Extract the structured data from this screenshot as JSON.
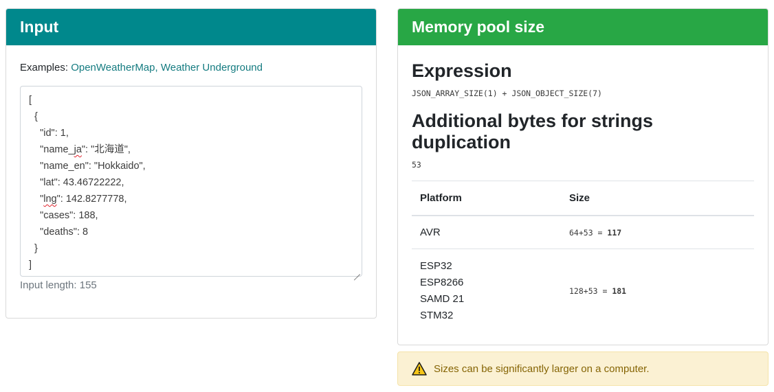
{
  "input_card": {
    "title": "Input",
    "examples_label": "Examples:",
    "example_links": [
      "OpenWeatherMap,",
      "Weather Underground"
    ],
    "json_lines": [
      "[",
      "  {",
      "    \"id\": 1,",
      "    \"name_ja\": \"北海道\",",
      "    \"name_en\": \"Hokkaido\",",
      "    \"lat\": 43.46722222,",
      "    \"lng\": 142.8277778,",
      "    \"cases\": 188,",
      "    \"deaths\": 8",
      "  }",
      "]"
    ],
    "input_length": "Input length: 155"
  },
  "result_card": {
    "title": "Memory pool size",
    "expression_heading": "Expression",
    "expression": "JSON_ARRAY_SIZE(1) + JSON_OBJECT_SIZE(7)",
    "additional_heading": "Additional bytes for strings duplication",
    "additional_bytes": "53",
    "table": {
      "headers": [
        "Platform",
        "Size"
      ],
      "rows": [
        {
          "platforms": [
            "AVR"
          ],
          "formula": "64+53 = ",
          "result": "117"
        },
        {
          "platforms": [
            "ESP32",
            "ESP8266",
            "SAMD 21",
            "STM32"
          ],
          "formula": "128+53 = ",
          "result": "181"
        }
      ]
    }
  },
  "alert": {
    "icon": "warning-icon",
    "text": "Sizes can be significantly larger on a computer."
  },
  "colors": {
    "input_header": "#00888c",
    "result_header": "#28a745",
    "link": "#147b80",
    "alert_bg": "#fbf1d3"
  }
}
